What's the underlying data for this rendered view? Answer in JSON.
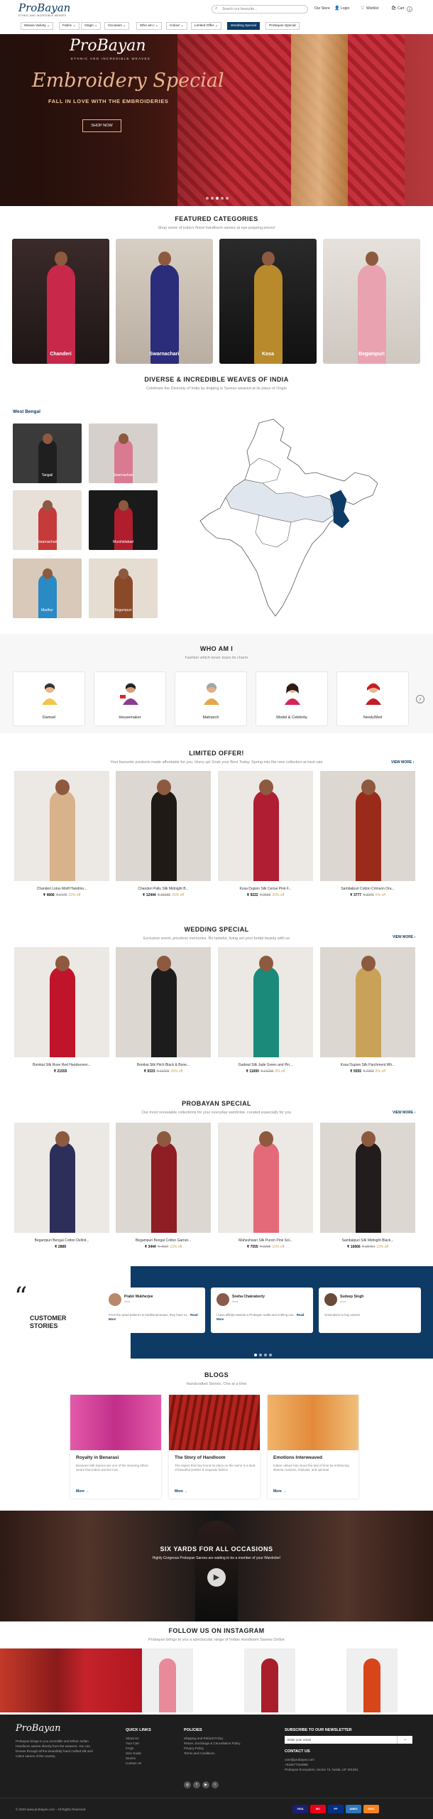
{
  "header": {
    "logo": "ProBayan",
    "logo_tagline": "ETHNIC AND INCREDIBLE WEAVES",
    "search_placeholder": "Search our favourite...",
    "our_store": "Our Store",
    "login": "Login",
    "wishlist": "Wishlist",
    "cart": "Cart",
    "cart_count": "0",
    "nav": [
      "Weave Variety",
      "Fabric",
      "Origin",
      "Occasion",
      "Who am I",
      "Colour",
      "Limited Offer",
      "Wedding Special",
      "Probayan Special"
    ]
  },
  "hero": {
    "logo": "ProBayan",
    "logo_tagline": "ETHNIC AND INCREDIBLE WEAVES",
    "title": "Embroidery Special",
    "subtitle": "FALL IN LOVE WITH THE EMBROIDERIES",
    "button": "SHOP NOW"
  },
  "featured": {
    "title": "FEATURED CATEGORIES",
    "subtitle": "Shop some of India's finest handloom sarees at eye-popping prices!",
    "items": [
      {
        "label": "Chanderi",
        "color": "#c8284a"
      },
      {
        "label": "Swarnachari",
        "color": "#2b2c7a"
      },
      {
        "label": "Kosa",
        "color": "#b88a2c"
      },
      {
        "label": "Begampuri",
        "color": "#e9a3b0"
      }
    ]
  },
  "weaves": {
    "title": "DIVERSE & INCREDIBLE WEAVES OF INDIA",
    "subtitle": "Celebrate the Diversity of India by draping in Sarees weaved at its place of Origin",
    "state": "West Bengal",
    "items": [
      {
        "label": "Tangail",
        "color": "#1f1f1f"
      },
      {
        "label": "Swarnachari",
        "color": "#d97a91"
      },
      {
        "label": "Swarnachari",
        "color": "#c73a3a"
      },
      {
        "label": "Murshidabad",
        "color": "#b01e2d"
      },
      {
        "label": "Madhur",
        "color": "#2a8ac4"
      },
      {
        "label": "Begampuri",
        "color": "#8a4a2a"
      }
    ]
  },
  "whoami": {
    "title": "WHO AM I",
    "subtitle": "Fashion which never loses its charm",
    "items": [
      "Damsel",
      "Housemaker",
      "Matriarch",
      "Model & Celebrity",
      "NewlyWed"
    ],
    "arrow": "›"
  },
  "limited": {
    "title": "LIMITED OFFER!",
    "subtitle": "Your favourite products made affordable for you. Hurry up! Grab your Best Today. Spring into the new collection at best rate",
    "view_more": "VIEW MORE",
    "products": [
      {
        "name": "Chanderi Lotus Motif Handmo...",
        "price": "₹ 4666",
        "old": "₹ 6479",
        "off": "22% off",
        "color": "#d8b28a"
      },
      {
        "name": "Chanderi Pallu Silk Midnight B...",
        "price": "₹ 12444",
        "old": "₹ 15555",
        "off": "20% off",
        "color": "#201a17"
      },
      {
        "name": "Kosa Dupion Silk Cerise Pink F...",
        "price": "₹ 9222",
        "old": "₹ 9555",
        "off": "20% off",
        "color": "#b01e34"
      },
      {
        "name": "Sambalpuri Cotton Crimson Ora...",
        "price": "₹ 3777",
        "old": "₹ 3976",
        "off": "5% off",
        "color": "#9a2a1a"
      }
    ]
  },
  "wedding": {
    "title": "WEDDING SPECIAL",
    "subtitle": "Exclusive event, priceless memories. Be tasteful, living set your bridal beauty with us",
    "view_more": "VIEW MORE",
    "products": [
      {
        "name": "Bomkai Silk Rose Red Handwoven...",
        "price": "₹ 21555",
        "old": "",
        "off": "",
        "color": "#c0142a"
      },
      {
        "name": "Bomkai Silk Pitch Black & Bone...",
        "price": "₹ 9333",
        "old": "₹ 11665",
        "off": "20% off",
        "color": "#1c1c1c"
      },
      {
        "name": "Gadwal Silk Jade Green and Pin...",
        "price": "₹ 11000",
        "old": "₹ 14220",
        "off": "6% off",
        "color": "#1b8a7a"
      },
      {
        "name": "Kosa Dupion Silk Parchment Wh...",
        "price": "₹ 5555",
        "old": "₹ 7060",
        "off": "8% off",
        "color": "#c9a25a"
      }
    ]
  },
  "probayan": {
    "title": "PROBAYAN SPECIAL",
    "subtitle": "Our most revealable collections for your everyday wardrobe, curated especially for you",
    "view_more": "VIEW MORE",
    "products": [
      {
        "name": "Begampuri Bengal Cotton Dellnit...",
        "price": "₹ 2888",
        "old": "",
        "off": "",
        "color": "#2b2f5a"
      },
      {
        "name": "Begampuri Bengal Cotton Garnet...",
        "price": "₹ 3444",
        "old": "₹ 4027",
        "off": "13% off",
        "color": "#8e1e24"
      },
      {
        "name": "Maheshwari Silk Punch Pink Sol...",
        "price": "₹ 7555",
        "old": "₹ 9295",
        "off": "10% off",
        "color": "#e46a7a"
      },
      {
        "name": "Sambalpuri Silk Midnight Black...",
        "price": "₹ 16666",
        "old": "₹ 18454",
        "off": "10% off",
        "color": "#231c1c"
      }
    ]
  },
  "customer": {
    "title_1": "CUSTOMER",
    "title_2": "STORIES",
    "quote": "“",
    "reviews": [
      {
        "name": "Prabir Mukherjee",
        "role": "Arca",
        "text": "From the wood patterns to traditional weave, they have so...",
        "read": "Read More"
      },
      {
        "name": "Sneha Chakraborty",
        "role": "Arca",
        "text": "I have affinity towards a Probayan outlet and nothing can...",
        "read": "Read More"
      },
      {
        "name": "Sudeep Singh",
        "role": "Arca",
        "text": "Great place to buy sarees!",
        "read": ""
      }
    ]
  },
  "blogs": {
    "title": "BLOGS",
    "subtitle": "Handcrafted Stories, One at a time",
    "items": [
      {
        "title": "Royalty in Benarasi",
        "desc": "Benarasi Silk Sarees are one of the stunning ethnic wears that Indian women love.",
        "more": "More",
        "color": "#d8469a"
      },
      {
        "title": "The Story of Handloom",
        "desc": "The region that has found its place on the name is a land of beautiful textiles & exquisite fabrics",
        "more": "More",
        "color": "#b2241c"
      },
      {
        "title": "Emotions Interweaved",
        "desc": "Indian culture has stood the test of time by embracing diverse customs, festivals, and spiritual.",
        "more": "More",
        "color": "#e89a52"
      }
    ]
  },
  "video": {
    "title": "SIX YARDS FOR ALL OCCASIONS",
    "subtitle": "Highly Gorgeous Probayan Sarees are waiting to be a member of your Wardrobe!",
    "play": "▶"
  },
  "instagram": {
    "title": "FOLLOW US ON INSTAGRAM",
    "subtitle": "Probayan brings to you a spectacular range of Indian Handloom Sarees Online",
    "colors": [
      "#c23a2a",
      "#b2161f",
      "#f0f0f0",
      "#f0f0f0",
      "#f0f0f0"
    ]
  },
  "footer": {
    "logo": "ProBayan",
    "about": "Probayan brings to you incredible and Ethnic Indian Handloom sarees directly from the weavers. You can browse through all the beautifully hand crafted silk and cotton sarees of the country.",
    "quick_links_title": "QUICK LINKS",
    "quick_links": [
      "About Us",
      "Your Cart",
      "FAQs",
      "Size Guide",
      "Stories",
      "Contact Us"
    ],
    "policies_title": "POLICIES",
    "policies": [
      "Shipping and Refund Policy",
      "Return, Exchange & Cancellation Policy",
      "Privacy Policy",
      "Terms and Conditions"
    ],
    "newsletter_title": "SUBSCRIBE TO OUR NEWSLETTER",
    "newsletter_placeholder": "Enter your email",
    "contact_title": "CONTACT US",
    "contact": [
      "care@probayan.com",
      "+919477164958",
      "Probayan Ecosystem, Sector 74, Noida, UP 201301"
    ],
    "copyright": "© 2023 www.probayan.com - All Rights Reserved",
    "payments": [
      "VISA",
      "MC",
      "PP",
      "AMEX",
      "DISC"
    ]
  }
}
